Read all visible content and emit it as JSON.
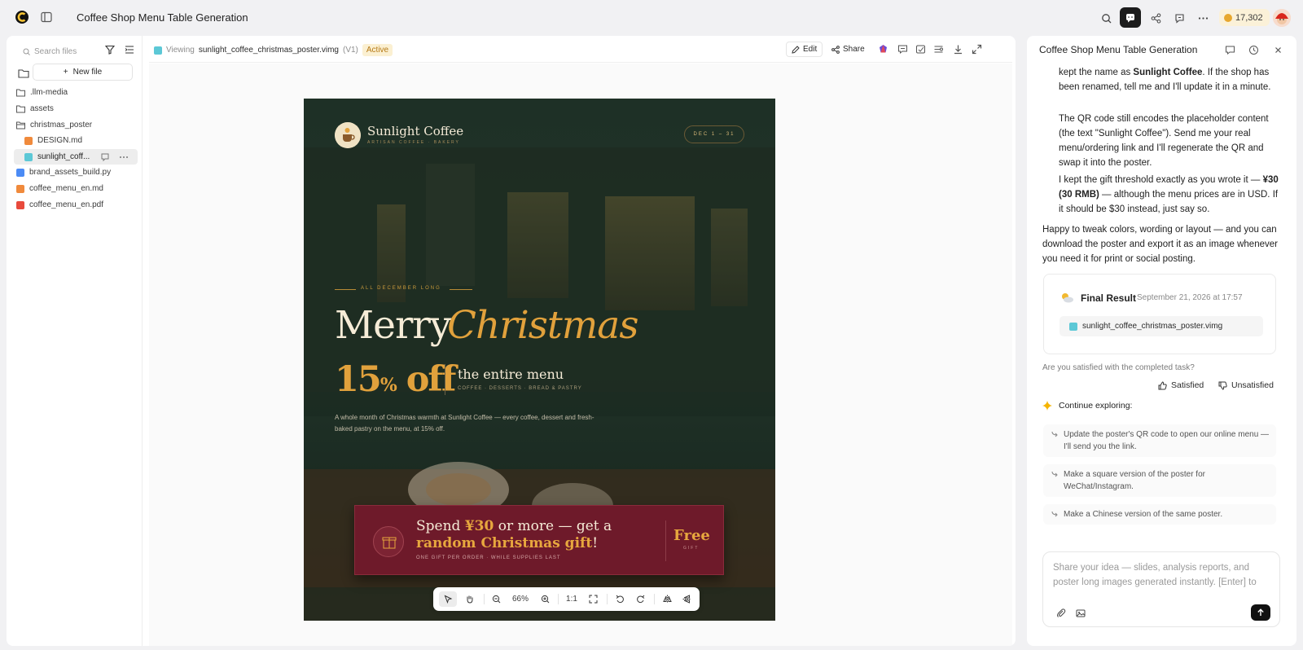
{
  "app": {
    "title": "Coffee Shop Menu Table Generation",
    "credits": "17,302"
  },
  "files": {
    "search_placeholder": "Search files",
    "new_file_label": "New file",
    "items": [
      {
        "name": ".llm-media",
        "type": "folder"
      },
      {
        "name": "assets",
        "type": "folder"
      },
      {
        "name": "christmas_poster",
        "type": "folder"
      },
      {
        "name": "DESIGN.md",
        "type": "md"
      },
      {
        "name": "sunlight_coff...",
        "type": "vimg"
      },
      {
        "name": "brand_assets_build.py",
        "type": "py"
      },
      {
        "name": "coffee_menu_en.md",
        "type": "md"
      },
      {
        "name": "coffee_menu_en.pdf",
        "type": "pdf"
      }
    ]
  },
  "viewer": {
    "viewing_label": "Viewing",
    "file_name": "sunlight_coffee_christmas_poster.vimg",
    "version": "(V1)",
    "status": "Active",
    "edit_label": "Edit",
    "share_label": "Share"
  },
  "poster": {
    "brand": "Sunlight Coffee",
    "tagline": "ARTISAN COFFEE · BAKERY",
    "date_range": "DEC 1 – 31",
    "kicker": "ALL DECEMBER LONG",
    "merry": "Merry",
    "christmas": "Christmas",
    "discount_number": "15",
    "discount_pct": "%",
    "discount_off": " off",
    "entire_menu": "the entire menu",
    "categories": "COFFEE · DESSERTS · BREAD & PASTRY",
    "description": "A whole month of Christmas warmth at Sunlight Coffee — every coffee, dessert and fresh-baked pastry on the menu, at 15% off.",
    "banner_spend_1": "Spend ",
    "banner_amount": "¥30",
    "banner_spend_2": " or more — get a ",
    "banner_gift": "random Christmas gift",
    "banner_end": "!",
    "banner_note": "ONE GIFT PER ORDER · WHILE SUPPLIES LAST",
    "free_label": "Free",
    "gift_label": "GIFT"
  },
  "zoom": {
    "level": "66%",
    "reset_label": "1:1"
  },
  "chat": {
    "title": "Coffee Shop Menu Table Generation",
    "msg1_prefix": "kept the name as ",
    "msg1_bold": "Sunlight Coffee",
    "msg1_suffix": ". If the shop has been renamed, tell me and I'll update it in a minute.",
    "msg2": "The QR code still encodes the placeholder content (the text \"Sunlight Coffee\"). Send me your real menu/ordering link and I'll regenerate the QR and swap it into the poster.",
    "msg3_prefix": "I kept the gift threshold exactly as you wrote it — ",
    "msg3_bold": "¥30 (30 RMB)",
    "msg3_suffix": " — although the menu prices are in USD. If it should be $30 instead, just say so.",
    "msg4": "Happy to tweak colors, wording or layout — and you can download the poster and export it as an image whenever you need it for print or social posting.",
    "result_title": "Final Result",
    "result_date": "September 21, 2026 at 17:57",
    "result_file": "sunlight_coffee_christmas_poster.vimg",
    "satisfied_question": "Are you satisfied with the completed task?",
    "satisfied_label": "Satisfied",
    "unsatisfied_label": "Unsatisfied",
    "explore_label": "Continue exploring:",
    "suggestions": [
      "Update the poster's QR code to open our online menu — I'll send you the link.",
      "Make a square version of the poster for WeChat/Instagram.",
      "Make a Chinese version of the same poster."
    ],
    "input_placeholder": "Share your idea — slides, analysis reports, and poster long images generated instantly. [Enter] to"
  },
  "colors": {
    "accent_gold": "#e1a13c",
    "banner_red": "#6e1a2a",
    "active_badge": "#fbf0d2"
  }
}
